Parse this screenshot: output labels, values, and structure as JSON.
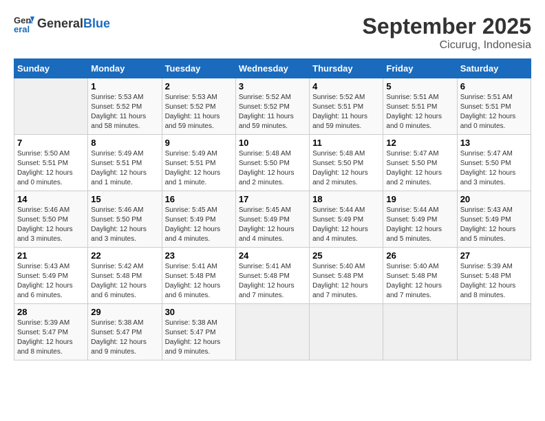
{
  "header": {
    "logo_general": "General",
    "logo_blue": "Blue",
    "month": "September 2025",
    "location": "Cicurug, Indonesia"
  },
  "days_of_week": [
    "Sunday",
    "Monday",
    "Tuesday",
    "Wednesday",
    "Thursday",
    "Friday",
    "Saturday"
  ],
  "weeks": [
    [
      {
        "day": "",
        "info": ""
      },
      {
        "day": "1",
        "info": "Sunrise: 5:53 AM\nSunset: 5:52 PM\nDaylight: 11 hours\nand 58 minutes."
      },
      {
        "day": "2",
        "info": "Sunrise: 5:53 AM\nSunset: 5:52 PM\nDaylight: 11 hours\nand 59 minutes."
      },
      {
        "day": "3",
        "info": "Sunrise: 5:52 AM\nSunset: 5:52 PM\nDaylight: 11 hours\nand 59 minutes."
      },
      {
        "day": "4",
        "info": "Sunrise: 5:52 AM\nSunset: 5:51 PM\nDaylight: 11 hours\nand 59 minutes."
      },
      {
        "day": "5",
        "info": "Sunrise: 5:51 AM\nSunset: 5:51 PM\nDaylight: 12 hours\nand 0 minutes."
      },
      {
        "day": "6",
        "info": "Sunrise: 5:51 AM\nSunset: 5:51 PM\nDaylight: 12 hours\nand 0 minutes."
      }
    ],
    [
      {
        "day": "7",
        "info": "Sunrise: 5:50 AM\nSunset: 5:51 PM\nDaylight: 12 hours\nand 0 minutes."
      },
      {
        "day": "8",
        "info": "Sunrise: 5:49 AM\nSunset: 5:51 PM\nDaylight: 12 hours\nand 1 minute."
      },
      {
        "day": "9",
        "info": "Sunrise: 5:49 AM\nSunset: 5:51 PM\nDaylight: 12 hours\nand 1 minute."
      },
      {
        "day": "10",
        "info": "Sunrise: 5:48 AM\nSunset: 5:50 PM\nDaylight: 12 hours\nand 2 minutes."
      },
      {
        "day": "11",
        "info": "Sunrise: 5:48 AM\nSunset: 5:50 PM\nDaylight: 12 hours\nand 2 minutes."
      },
      {
        "day": "12",
        "info": "Sunrise: 5:47 AM\nSunset: 5:50 PM\nDaylight: 12 hours\nand 2 minutes."
      },
      {
        "day": "13",
        "info": "Sunrise: 5:47 AM\nSunset: 5:50 PM\nDaylight: 12 hours\nand 3 minutes."
      }
    ],
    [
      {
        "day": "14",
        "info": "Sunrise: 5:46 AM\nSunset: 5:50 PM\nDaylight: 12 hours\nand 3 minutes."
      },
      {
        "day": "15",
        "info": "Sunrise: 5:46 AM\nSunset: 5:50 PM\nDaylight: 12 hours\nand 3 minutes."
      },
      {
        "day": "16",
        "info": "Sunrise: 5:45 AM\nSunset: 5:49 PM\nDaylight: 12 hours\nand 4 minutes."
      },
      {
        "day": "17",
        "info": "Sunrise: 5:45 AM\nSunset: 5:49 PM\nDaylight: 12 hours\nand 4 minutes."
      },
      {
        "day": "18",
        "info": "Sunrise: 5:44 AM\nSunset: 5:49 PM\nDaylight: 12 hours\nand 4 minutes."
      },
      {
        "day": "19",
        "info": "Sunrise: 5:44 AM\nSunset: 5:49 PM\nDaylight: 12 hours\nand 5 minutes."
      },
      {
        "day": "20",
        "info": "Sunrise: 5:43 AM\nSunset: 5:49 PM\nDaylight: 12 hours\nand 5 minutes."
      }
    ],
    [
      {
        "day": "21",
        "info": "Sunrise: 5:43 AM\nSunset: 5:49 PM\nDaylight: 12 hours\nand 6 minutes."
      },
      {
        "day": "22",
        "info": "Sunrise: 5:42 AM\nSunset: 5:48 PM\nDaylight: 12 hours\nand 6 minutes."
      },
      {
        "day": "23",
        "info": "Sunrise: 5:41 AM\nSunset: 5:48 PM\nDaylight: 12 hours\nand 6 minutes."
      },
      {
        "day": "24",
        "info": "Sunrise: 5:41 AM\nSunset: 5:48 PM\nDaylight: 12 hours\nand 7 minutes."
      },
      {
        "day": "25",
        "info": "Sunrise: 5:40 AM\nSunset: 5:48 PM\nDaylight: 12 hours\nand 7 minutes."
      },
      {
        "day": "26",
        "info": "Sunrise: 5:40 AM\nSunset: 5:48 PM\nDaylight: 12 hours\nand 7 minutes."
      },
      {
        "day": "27",
        "info": "Sunrise: 5:39 AM\nSunset: 5:48 PM\nDaylight: 12 hours\nand 8 minutes."
      }
    ],
    [
      {
        "day": "28",
        "info": "Sunrise: 5:39 AM\nSunset: 5:47 PM\nDaylight: 12 hours\nand 8 minutes."
      },
      {
        "day": "29",
        "info": "Sunrise: 5:38 AM\nSunset: 5:47 PM\nDaylight: 12 hours\nand 9 minutes."
      },
      {
        "day": "30",
        "info": "Sunrise: 5:38 AM\nSunset: 5:47 PM\nDaylight: 12 hours\nand 9 minutes."
      },
      {
        "day": "",
        "info": ""
      },
      {
        "day": "",
        "info": ""
      },
      {
        "day": "",
        "info": ""
      },
      {
        "day": "",
        "info": ""
      }
    ]
  ]
}
